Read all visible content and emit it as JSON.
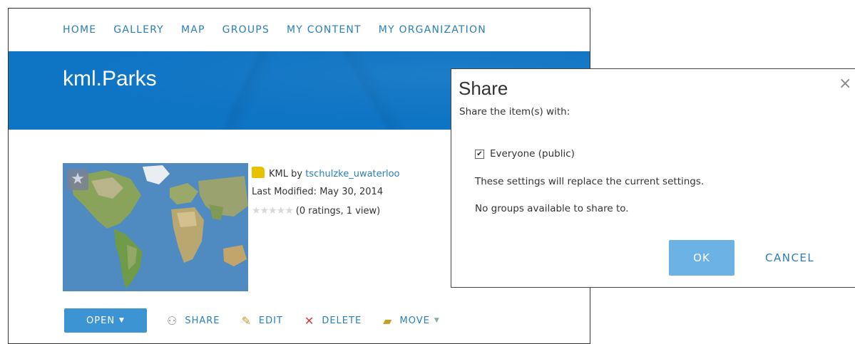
{
  "nav": {
    "items": [
      "HOME",
      "GALLERY",
      "MAP",
      "GROUPS",
      "MY CONTENT",
      "MY ORGANIZATION"
    ]
  },
  "item": {
    "title": "kml.Parks",
    "type_label": "KML",
    "by_text": "by",
    "owner": "tschulzke_uwaterloo",
    "modified": "Last Modified: May 30, 2014",
    "ratings_text": "(0 ratings, 1 view)",
    "rating_value": 0,
    "rating_max": 5
  },
  "actions": {
    "open": "OPEN",
    "share": "SHARE",
    "edit": "EDIT",
    "delete": "DELETE",
    "move": "MOVE"
  },
  "dialog": {
    "title": "Share",
    "share_with_label": "Share the item(s) with:",
    "everyone_label": "Everyone (public)",
    "everyone_checked": true,
    "replace_notice": "These settings will replace the current settings.",
    "no_groups": "No groups available to share to.",
    "ok": "OK",
    "cancel": "CANCEL",
    "close": "×"
  },
  "icons": {
    "favorite": "star-icon",
    "share": "share-icon",
    "edit": "pencil-icon",
    "delete": "x-icon",
    "move": "folder-icon"
  },
  "colors": {
    "banner": "#0e74c4",
    "link": "#2a7fb8",
    "button": "#3d94d3",
    "ok_button": "#6db2e5"
  }
}
